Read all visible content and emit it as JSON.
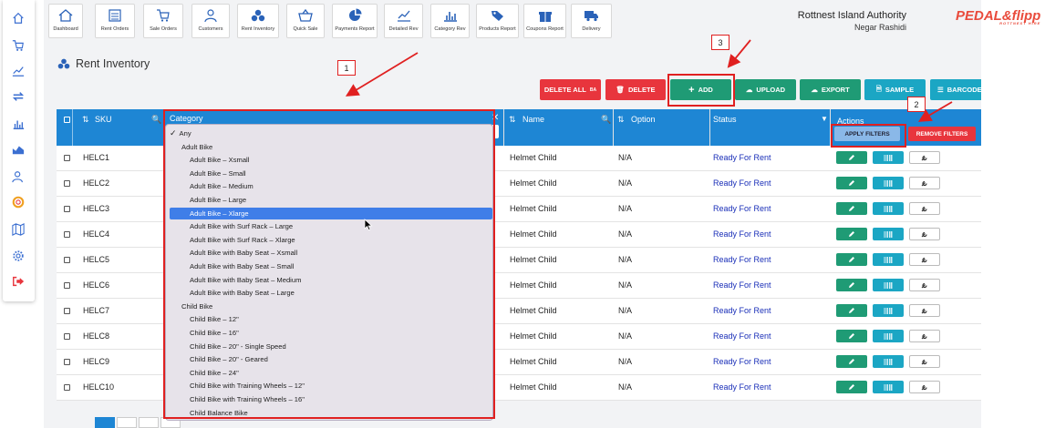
{
  "topnav": {
    "items": [
      {
        "label": "Dashboard",
        "icon": "home-icon"
      },
      {
        "label": "Rent Orders",
        "icon": "calendar-icon"
      },
      {
        "label": "Sale Orders",
        "icon": "cart-icon"
      },
      {
        "label": "Customers",
        "icon": "users-icon"
      },
      {
        "label": "Rent Inventory",
        "icon": "bikes-icon"
      },
      {
        "label": "Quick Sale",
        "icon": "basket-icon"
      },
      {
        "label": "Payments Report",
        "icon": "pie-chart-icon"
      },
      {
        "label": "Detailed Rev",
        "icon": "line-chart-icon"
      },
      {
        "label": "Category Rev",
        "icon": "bar-chart-icon"
      },
      {
        "label": "Products Report",
        "icon": "tags-icon"
      },
      {
        "label": "Coupons Report",
        "icon": "gift-icon"
      },
      {
        "label": "Delivery",
        "icon": "truck-icon"
      }
    ]
  },
  "header": {
    "org_name": "Rottnest Island Authority",
    "user_name": "Negar Rashidi",
    "logo_text": "PEDAL&flipp",
    "logo_sub": "ROTTNEST HIRE"
  },
  "page": {
    "title": "Rent Inventory"
  },
  "toolbar": {
    "delete_all": "DELETE ALL",
    "delete_all_sup": "BA",
    "delete": "DELETE",
    "add": "ADD",
    "upload": "UPLOAD",
    "export": "EXPORT",
    "sample": "SAMPLE",
    "barcodes": "BARCODES",
    "apply_filters": "APPLY FILTERS",
    "remove_filters": "REMOVE FILTERS"
  },
  "table": {
    "headers": {
      "sku": "SKU",
      "category": "Category",
      "name": "Name",
      "option": "Option",
      "status": "Status",
      "actions": "Actions"
    },
    "rows": [
      {
        "sku": "HELC1",
        "name": "Helmet Child",
        "option": "N/A",
        "status": "Ready For Rent"
      },
      {
        "sku": "HELC2",
        "name": "Helmet Child",
        "option": "N/A",
        "status": "Ready For Rent"
      },
      {
        "sku": "HELC3",
        "name": "Helmet Child",
        "option": "N/A",
        "status": "Ready For Rent"
      },
      {
        "sku": "HELC4",
        "name": "Helmet Child",
        "option": "N/A",
        "status": "Ready For Rent"
      },
      {
        "sku": "HELC5",
        "name": "Helmet Child",
        "option": "N/A",
        "status": "Ready For Rent"
      },
      {
        "sku": "HELC6",
        "name": "Helmet Child",
        "option": "N/A",
        "status": "Ready For Rent"
      },
      {
        "sku": "HELC7",
        "name": "Helmet Child",
        "option": "N/A",
        "status": "Ready For Rent"
      },
      {
        "sku": "HELC8",
        "name": "Helmet Child",
        "option": "N/A",
        "status": "Ready For Rent"
      },
      {
        "sku": "HELC9",
        "name": "Helmet Child",
        "option": "N/A",
        "status": "Ready For Rent"
      },
      {
        "sku": "HELC10",
        "name": "Helmet Child",
        "option": "N/A",
        "status": "Ready For Rent"
      }
    ]
  },
  "category_dropdown": {
    "selected": "Any",
    "highlighted": "Adult Bike – Xlarge",
    "options": [
      {
        "label": "Any",
        "level": "any"
      },
      {
        "label": "Adult Bike",
        "level": "group"
      },
      {
        "label": "Adult Bike – Xsmall",
        "level": "child"
      },
      {
        "label": "Adult Bike – Small",
        "level": "child"
      },
      {
        "label": "Adult Bike – Medium",
        "level": "child"
      },
      {
        "label": "Adult Bike – Large",
        "level": "child"
      },
      {
        "label": "Adult Bike – Xlarge",
        "level": "child"
      },
      {
        "label": "Adult Bike with Surf Rack – Large",
        "level": "child"
      },
      {
        "label": "Adult Bike with Surf Rack – Xlarge",
        "level": "child"
      },
      {
        "label": "Adult Bike with Baby Seat – Xsmall",
        "level": "child"
      },
      {
        "label": "Adult Bike with Baby Seat – Small",
        "level": "child"
      },
      {
        "label": "Adult Bike with Baby Seat – Medium",
        "level": "child"
      },
      {
        "label": "Adult Bike with Baby Seat – Large",
        "level": "child"
      },
      {
        "label": "Child Bike",
        "level": "group"
      },
      {
        "label": "Child Bike – 12\"",
        "level": "child"
      },
      {
        "label": "Child Bike – 16\"",
        "level": "child"
      },
      {
        "label": "Child Bike – 20\" - Single Speed",
        "level": "child"
      },
      {
        "label": "Child Bike – 20\" - Geared",
        "level": "child"
      },
      {
        "label": "Child Bike – 24\"",
        "level": "child"
      },
      {
        "label": "Child Bike with Training Wheels – 12\"",
        "level": "child"
      },
      {
        "label": "Child Bike with Training Wheels – 16\"",
        "level": "child"
      },
      {
        "label": "Child Balance Bike",
        "level": "child"
      }
    ]
  },
  "annotations": {
    "callout_1": "1",
    "callout_2": "2",
    "callout_3": "3"
  },
  "colors": {
    "primary": "#1e86d4",
    "danger": "#e8353d",
    "success": "#1f9b75",
    "info": "#1ba6c4",
    "annotation": "#e02020"
  }
}
